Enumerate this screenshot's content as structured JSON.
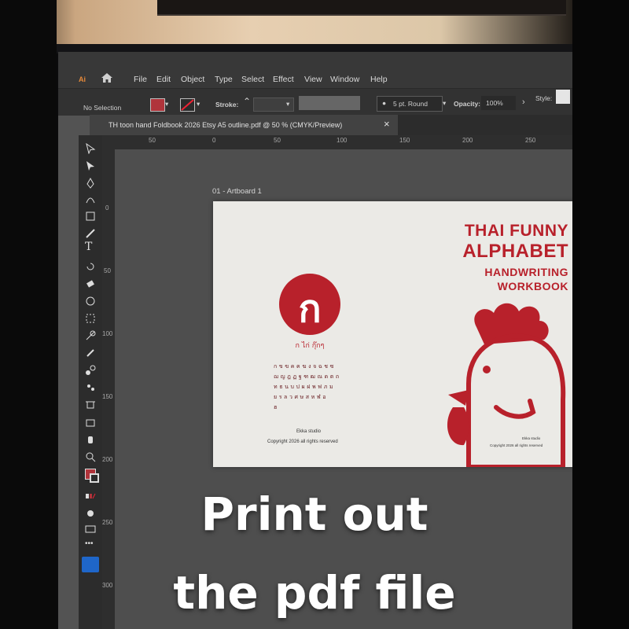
{
  "app": {
    "logo": "Ai",
    "menu": [
      "File",
      "Edit",
      "Object",
      "Type",
      "Select",
      "Effect",
      "View",
      "Window",
      "Help"
    ]
  },
  "control_bar": {
    "selection": "No Selection",
    "stroke_label": "Stroke:",
    "brush": "5 pt. Round",
    "opacity_label": "Opacity:",
    "opacity_value": "100%",
    "style_label": "Style:",
    "colors": {
      "fill": "#b0343b"
    }
  },
  "document": {
    "tab_title": "TH toon hand Foldbook 2026  Etsy A5 outline.pdf @ 50 % (CMYK/Preview)",
    "close_glyph": "×"
  },
  "ruler": {
    "horizontal": [
      "50",
      "0",
      "50",
      "100",
      "150",
      "200",
      "250"
    ],
    "vertical": [
      "0",
      "50",
      "100",
      "150",
      "200",
      "250",
      "300"
    ]
  },
  "artboard": {
    "label": "01 - Artboard 1",
    "title_lines": [
      "THAI FUNNY",
      "ALPHABET",
      "HANDWRITING",
      "WORKBOOK"
    ],
    "logo_glyph": "ก",
    "logo_caption": "ก ไก่ กุ๊กๆ",
    "alphabet_rows": [
      "กขฃคฅฆงจฉชซ",
      "ฌญฎฏฐฑฒณดตถ",
      "ทธนบปผฝพฟภม",
      "ยรลวศษสหฬอ",
      "ฮ"
    ],
    "studio": "Ekka studio",
    "copyright": "Copyright 2026 all rights reserved",
    "studio_small": "Ekka studio",
    "copyright_small": "Copyright 2026 all rights reserved",
    "accent": "#b8212b"
  },
  "overlay": {
    "line1": "Print out",
    "line2": "the pdf file"
  }
}
